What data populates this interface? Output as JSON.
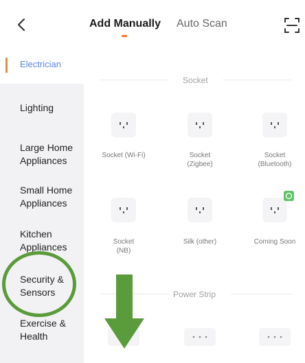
{
  "header": {
    "tabs": [
      {
        "label": "Add Manually",
        "active": true
      },
      {
        "label": "Auto Scan",
        "active": false
      }
    ]
  },
  "sidebar": {
    "items": [
      {
        "label": "Electrician",
        "active": true
      },
      {
        "label": "Lighting"
      },
      {
        "label": "Large Home Appliances"
      },
      {
        "label": "Small Home Appliances"
      },
      {
        "label": "Kitchen Appliances"
      },
      {
        "label": "Security & Sensors"
      },
      {
        "label": "Exercise & Health"
      }
    ]
  },
  "sections": [
    {
      "title": "Socket",
      "devices": [
        {
          "label": "Socket (Wi-Fi)"
        },
        {
          "label": "Socket (Zigbee)"
        },
        {
          "label": "Socket (Bluetooth)"
        },
        {
          "label": "Socket (NB)"
        },
        {
          "label": "Silk (other)"
        },
        {
          "label": "Coming Soon",
          "badge": true
        }
      ]
    },
    {
      "title": "Power Strip",
      "devices": [
        {
          "label": ""
        },
        {
          "label": ""
        },
        {
          "label": ""
        }
      ]
    }
  ],
  "colors": {
    "accent": "#5b86e0",
    "tab_indicator": "#ff6a1a",
    "annotation": "#5a9b3c",
    "badge": "#62c26a"
  },
  "icons": {
    "back": "chevron-left-icon",
    "scan": "scan-icon",
    "socket": "socket-icon",
    "power_strip": "power-strip-icon"
  }
}
